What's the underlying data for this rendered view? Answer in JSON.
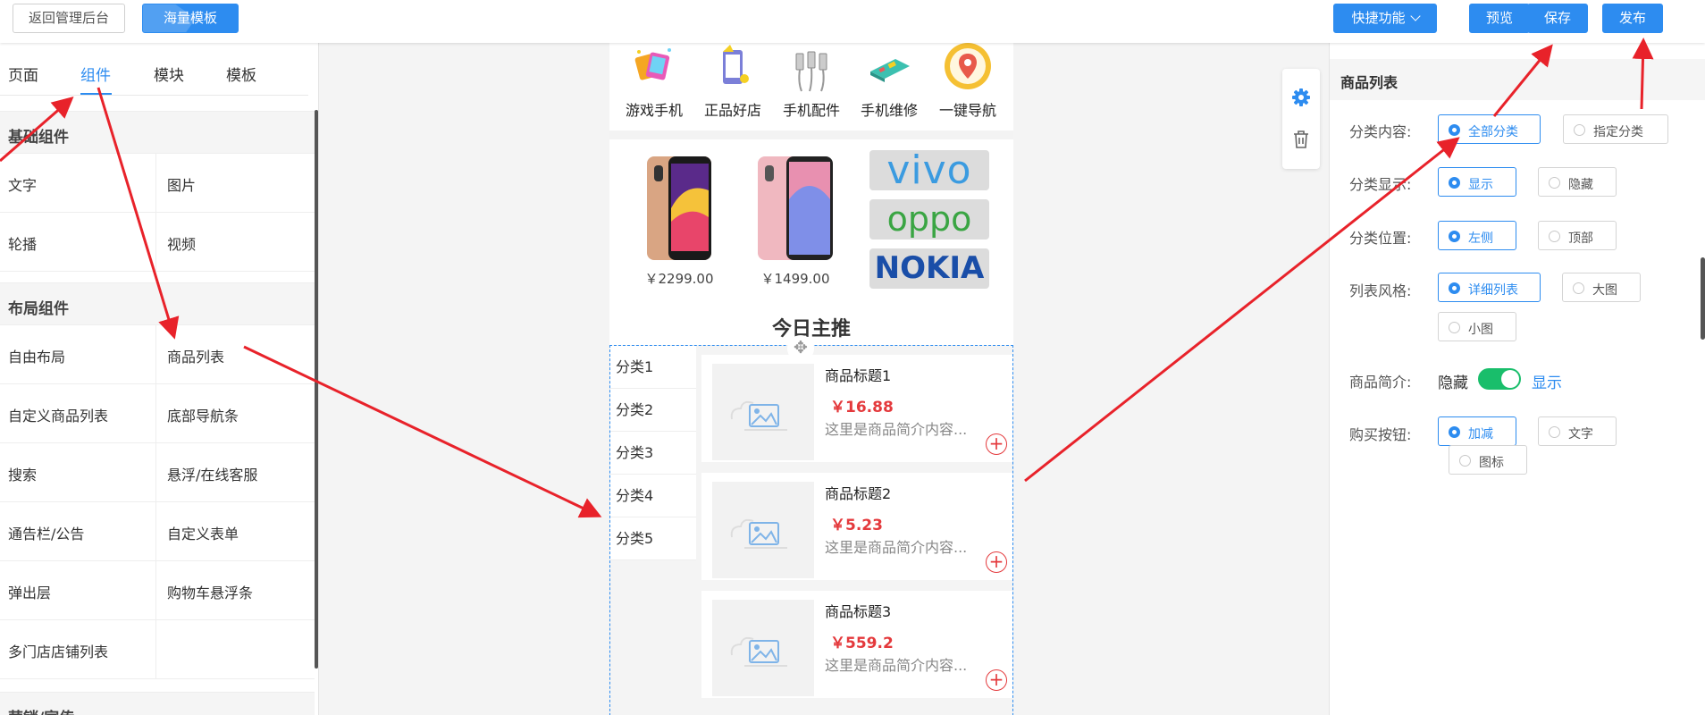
{
  "topbar": {
    "back_label": "返回管理后台",
    "templates_label": "海量模板",
    "quick_label": "快捷功能",
    "preview_label": "预览",
    "save_label": "保存",
    "publish_label": "发布"
  },
  "left_panel": {
    "tabs": [
      "页面",
      "组件",
      "模块",
      "模板"
    ],
    "active_tab": "组件",
    "basic_section": "基础组件",
    "basic_items": [
      "文字",
      "图片",
      "轮播",
      "视频"
    ],
    "layout_section": "布局组件",
    "layout_items": [
      "自由布局",
      "商品列表",
      "自定义商品列表",
      "底部导航条",
      "搜索",
      "悬浮/在线客服",
      "通告栏/公告",
      "自定义表单",
      "弹出层",
      "购物车悬浮条",
      "多门店店铺列表"
    ],
    "marketing_section": "营销/宣传"
  },
  "canvas": {
    "nav_items": [
      "游戏手机",
      "正品好店",
      "手机配件",
      "手机维修",
      "一键导航"
    ],
    "products": [
      {
        "price": "￥2299.00"
      },
      {
        "price": "￥1499.00"
      }
    ],
    "brands": [
      "vivo",
      "oppo",
      "NOKIA"
    ],
    "featured_title": "今日主推",
    "categories": [
      "分类1",
      "分类2",
      "分类3",
      "分类4",
      "分类5"
    ],
    "goods": [
      {
        "title": "商品标题1",
        "price": "￥16.88",
        "desc": "这里是商品简介内容..."
      },
      {
        "title": "商品标题2",
        "price": "￥5.23",
        "desc": "这里是商品简介内容..."
      },
      {
        "title": "商品标题3",
        "price": "￥559.2",
        "desc": "这里是商品简介内容..."
      }
    ]
  },
  "right_panel": {
    "title": "商品列表",
    "category_content_label": "分类内容:",
    "category_content_options": [
      "全部分类",
      "指定分类"
    ],
    "category_display_label": "分类显示:",
    "category_display_options": [
      "显示",
      "隐藏"
    ],
    "category_position_label": "分类位置:",
    "category_position_options": [
      "左侧",
      "顶部"
    ],
    "list_style_label": "列表风格:",
    "list_style_options": [
      "详细列表",
      "大图",
      "小图"
    ],
    "intro_label": "商品简介:",
    "intro_off": "隐藏",
    "intro_on": "显示",
    "intro_enabled": true,
    "buy_button_label": "购买按钮:",
    "buy_button_options": [
      "加减",
      "文字",
      "图标"
    ]
  },
  "colors": {
    "accent": "#2d8cf0",
    "price_red": "#e4393c",
    "toggle_green": "#19be6b",
    "arrow_red": "#e8222a"
  }
}
